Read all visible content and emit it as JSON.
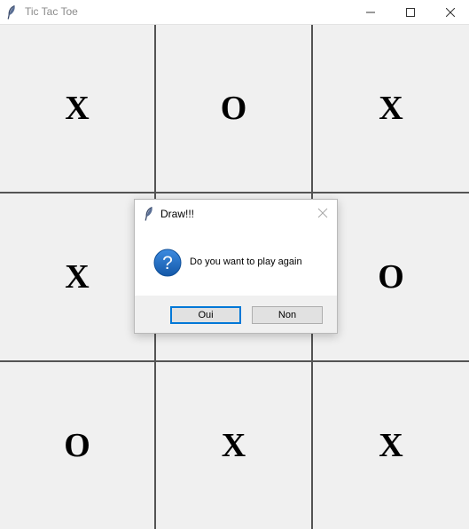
{
  "window": {
    "title": "Tic Tac Toe",
    "icon": "feather-icon",
    "controls": [
      "minimize-icon",
      "maximize-icon",
      "close-icon"
    ]
  },
  "board": {
    "cells": [
      "X",
      "O",
      "X",
      "X",
      "",
      "O",
      "O",
      "X",
      "X"
    ]
  },
  "dialog": {
    "title": "Draw!!!",
    "icon": "question-icon",
    "message": "Do you want to play again",
    "buttons": {
      "yes": "Oui",
      "no": "Non"
    }
  },
  "colors": {
    "background": "#f0f0f0",
    "grid_line": "#545454",
    "question_icon": "#1c6fc4",
    "default_button_border": "#0078d7"
  }
}
